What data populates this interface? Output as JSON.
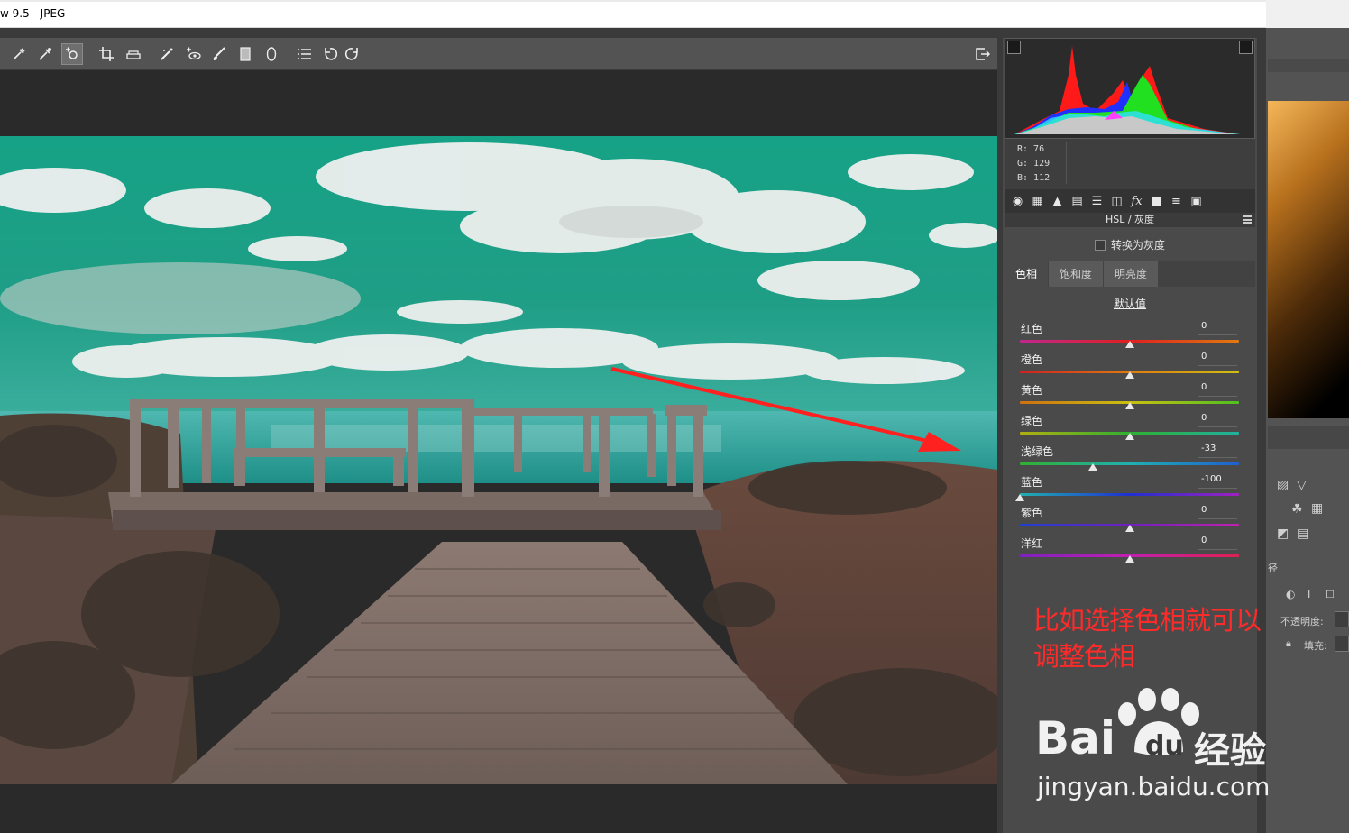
{
  "window": {
    "title": "w 9.5 -  JPEG"
  },
  "toolbar": {
    "tools": [
      {
        "name": "white-balance-tool-icon",
        "glyph": ""
      },
      {
        "name": "color-sampler-tool-icon",
        "glyph": ""
      },
      {
        "name": "targeted-adjustment-tool-icon",
        "glyph": ""
      },
      {
        "name": "crop-tool-icon",
        "glyph": ""
      },
      {
        "name": "straighten-tool-icon",
        "glyph": ""
      },
      {
        "name": "spot-removal-tool-icon",
        "glyph": ""
      },
      {
        "name": "red-eye-tool-icon",
        "glyph": ""
      },
      {
        "name": "adjustment-brush-icon",
        "glyph": ""
      },
      {
        "name": "graduated-filter-icon",
        "glyph": ""
      },
      {
        "name": "radial-filter-icon",
        "glyph": ""
      },
      {
        "name": "preferences-icon",
        "glyph": ""
      },
      {
        "name": "rotate-left-icon",
        "glyph": ""
      },
      {
        "name": "rotate-right-icon",
        "glyph": ""
      }
    ]
  },
  "readout": {
    "r": "R:  76",
    "g": "G: 129",
    "b": "B: 112"
  },
  "panel": {
    "name": "HSL / 灰度",
    "convert_gray": "转换为灰度",
    "tabs": [
      "色相",
      "饱和度",
      "明亮度"
    ],
    "default": "默认值",
    "sliders": [
      {
        "label": "红色",
        "value": "0",
        "pos": 0.5
      },
      {
        "label": "橙色",
        "value": "0",
        "pos": 0.5
      },
      {
        "label": "黄色",
        "value": "0",
        "pos": 0.5
      },
      {
        "label": "绿色",
        "value": "0",
        "pos": 0.5
      },
      {
        "label": "浅绿色",
        "value": "-33",
        "pos": 0.335
      },
      {
        "label": "蓝色",
        "value": "-100",
        "pos": 0.0
      },
      {
        "label": "紫色",
        "value": "0",
        "pos": 0.5
      },
      {
        "label": "洋红",
        "value": "0",
        "pos": 0.5
      }
    ]
  },
  "farright": {
    "opacity": "不透明度:",
    "fill": "填充:",
    "path_label": "径"
  },
  "annotation": {
    "line1": "比如选择色相就可以",
    "line2": "调整色相"
  },
  "watermark": {
    "brand": "Bai",
    "brand2": "du",
    "cn": "经验",
    "url": "jingyan.baidu.com"
  },
  "colors": {
    "sky": "#1e9e86",
    "deck": "#7e6a62",
    "arrow": "#ff2020",
    "annot": "#ff2a2a"
  }
}
